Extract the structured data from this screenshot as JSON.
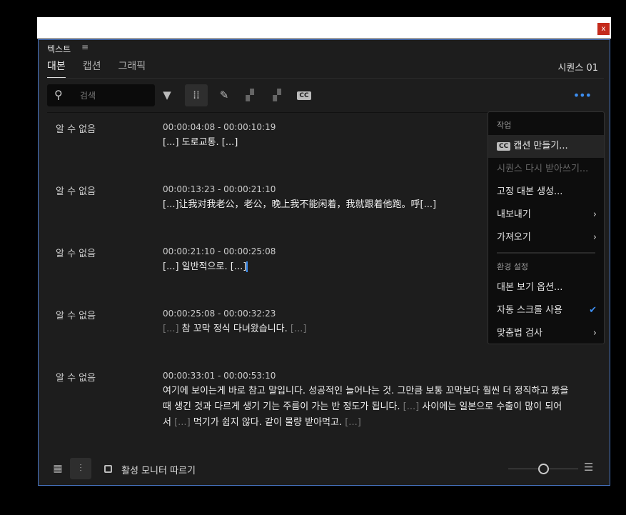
{
  "window": {
    "close_label": "x"
  },
  "panel": {
    "title": "텍스트",
    "tabs": [
      "대본",
      "캡션",
      "그래픽"
    ],
    "sequence": "시퀀스 01"
  },
  "search": {
    "placeholder": "검색"
  },
  "segments": [
    {
      "speaker": "알 수 없음",
      "time": "00:00:04:08 - 00:00:10:19",
      "parts": [
        {
          "t": "[...] 도로교통. [...]",
          "dim": false
        }
      ]
    },
    {
      "speaker": "알 수 없음",
      "time": "00:00:13:23 - 00:00:21:10",
      "parts": [
        {
          "t": "[...]让我对我老公，老公，晚上我不能闲着，我就跟着他跑。呼[...]",
          "dim": false
        }
      ]
    },
    {
      "speaker": "알 수 없음",
      "time": "00:00:21:10 - 00:00:25:08",
      "parts": [
        {
          "t": "[...] 일반적으로. [...]",
          "dim": false
        }
      ]
    },
    {
      "speaker": "알 수 없음",
      "time": "00:00:25:08 - 00:00:32:23",
      "parts": [
        {
          "t": "[...]",
          "dim": true
        },
        {
          "t": " 참 꼬막 정식 다녀왔습니다. ",
          "dim": false
        },
        {
          "t": "[...]",
          "dim": true
        }
      ]
    },
    {
      "speaker": "알 수 없음",
      "time": "00:00:33:01 - 00:00:53:10",
      "parts": [
        {
          "t": "여기에 보이는게 바로 참고 말입니다. 성공적인 늘어나는 것. 그만큼 보통 꼬막보다 훨씬 더 정직하고 봤을 때 생긴 것과 다르게 생기 기는 주름이 가는 반 정도가 됩니다. ",
          "dim": false
        },
        {
          "t": "[...]",
          "dim": true
        },
        {
          "t": " 사이에는 일본으로 수출이 많이 되어서 ",
          "dim": false
        },
        {
          "t": "[...]",
          "dim": true
        },
        {
          "t": " 먹기가 쉽지 않다. 같이 물량 받아먹고. ",
          "dim": false
        },
        {
          "t": "[...]",
          "dim": true
        }
      ]
    }
  ],
  "menu": {
    "header1": "작업",
    "cc_badge": "CC",
    "items1": [
      "캡션 만들기...",
      "시퀀스 다시 받아쓰기...",
      "고정 대본 생성...",
      "내보내기",
      "가져오기"
    ],
    "header2": "환경 설정",
    "items2": [
      "대본 보기 옵션...",
      "자동 스크롤 사용",
      "맞춤법 검사"
    ]
  },
  "footer": {
    "follow_label": "활성 모니터 따르기",
    "follow_checked": false
  },
  "colors": {
    "accent": "#3d8ef0",
    "panel_bg": "#1d1d1d"
  }
}
